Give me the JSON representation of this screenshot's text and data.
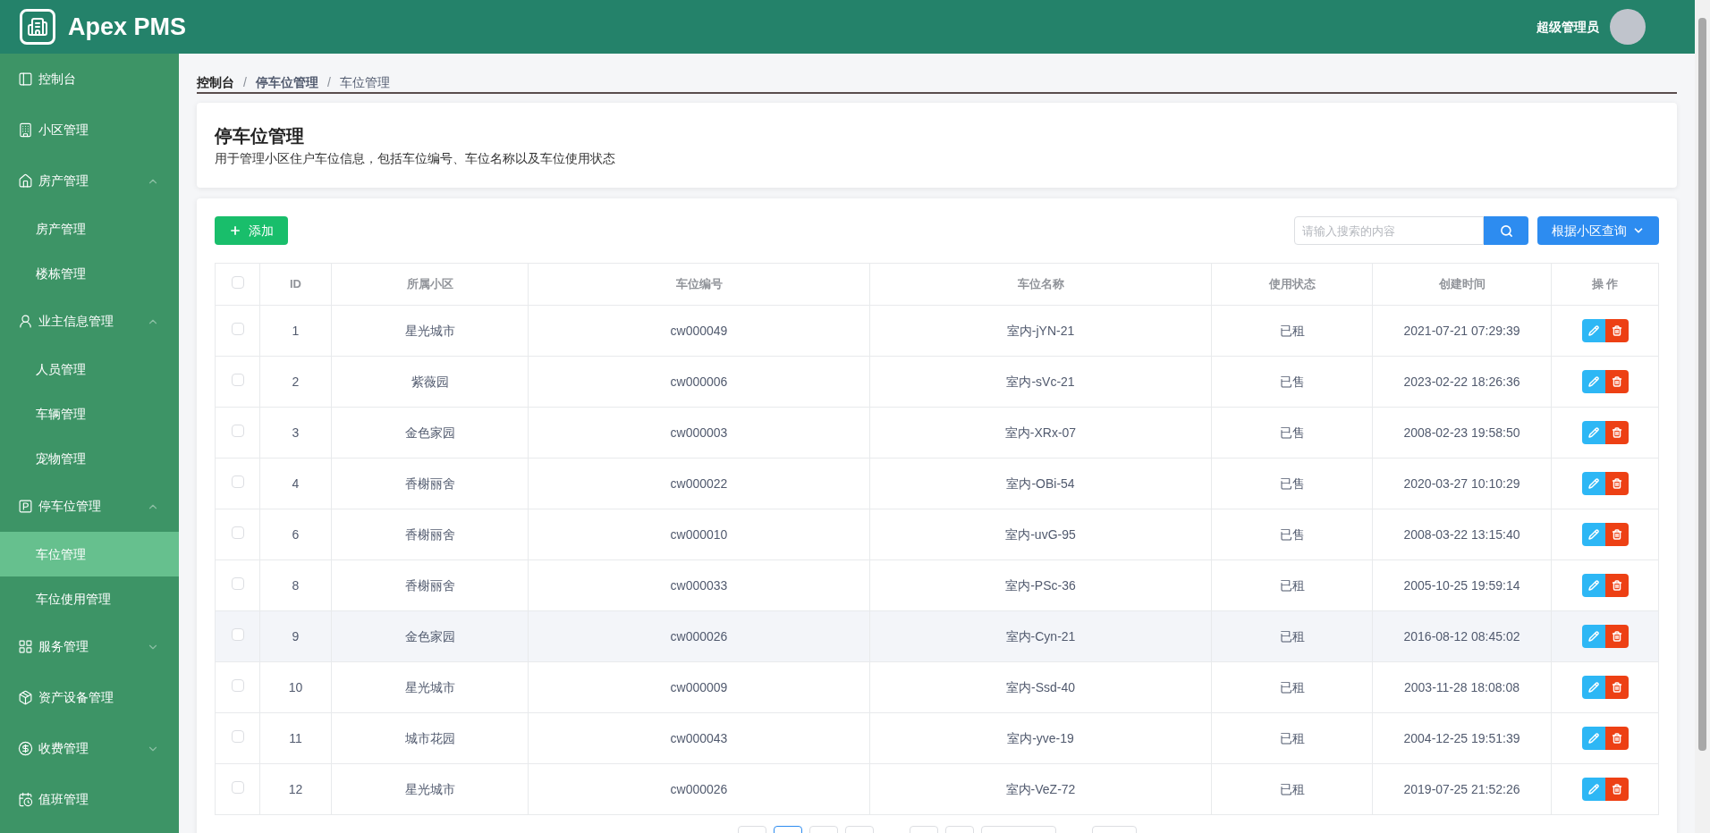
{
  "header": {
    "brand": "Apex PMS",
    "user": "超级管理员"
  },
  "sidebar": {
    "items": [
      {
        "label": "控制台",
        "selected": false
      },
      {
        "label": "小区管理",
        "selected": false
      },
      {
        "label": "房产管理",
        "selected": false,
        "expanded": true,
        "children": [
          {
            "label": "房产管理",
            "selected": false
          },
          {
            "label": "楼栋管理",
            "selected": false
          }
        ]
      },
      {
        "label": "业主信息管理",
        "selected": false,
        "expanded": true,
        "children": [
          {
            "label": "人员管理",
            "selected": false
          },
          {
            "label": "车辆管理",
            "selected": false
          },
          {
            "label": "宠物管理",
            "selected": false
          }
        ]
      },
      {
        "label": "停车位管理",
        "selected": false,
        "expanded": true,
        "children": [
          {
            "label": "车位管理",
            "selected": true
          },
          {
            "label": "车位使用管理",
            "selected": false
          }
        ]
      },
      {
        "label": "服务管理",
        "selected": false,
        "expanded": false
      },
      {
        "label": "资产设备管理",
        "selected": false
      },
      {
        "label": "收费管理",
        "selected": false,
        "expanded": false
      },
      {
        "label": "值班管理",
        "selected": false
      }
    ]
  },
  "breadcrumb": [
    {
      "text": "控制台"
    },
    {
      "separator": "/",
      "text": "停车位管理"
    },
    {
      "separator": "/",
      "text": "车位管理"
    }
  ],
  "page": {
    "title": "停车位管理",
    "description": "用于管理小区住户车位信息，包括车位编号、车位名称以及车位使用状态"
  },
  "toolbar": {
    "add_button": "添加",
    "search": {
      "placeholder": "请输入搜索的内容"
    },
    "filter_button": "根据小区查询"
  },
  "table": {
    "header_checked": false,
    "columns": [
      "ID",
      "所属小区",
      "车位编号",
      "车位名称",
      "使用状态",
      "创建时间",
      "操 作"
    ],
    "rows": [
      {
        "checked": false,
        "hovered": false,
        "cells": [
          "1",
          "星光城市",
          "cw000049",
          "室内-jYN-21",
          "已租",
          "2021-07-21 07:29:39"
        ]
      },
      {
        "checked": false,
        "hovered": false,
        "cells": [
          "2",
          "紫薇园",
          "cw000006",
          "室内-sVc-21",
          "已售",
          "2023-02-22 18:26:36"
        ]
      },
      {
        "checked": false,
        "hovered": false,
        "cells": [
          "3",
          "金色家园",
          "cw000003",
          "室内-XRx-07",
          "已售",
          "2008-02-23 19:58:50"
        ]
      },
      {
        "checked": false,
        "hovered": false,
        "cells": [
          "4",
          "香榭丽舍",
          "cw000022",
          "室内-OBi-54",
          "已售",
          "2020-03-27 10:10:29"
        ]
      },
      {
        "checked": false,
        "hovered": false,
        "cells": [
          "6",
          "香榭丽舍",
          "cw000010",
          "室内-uvG-95",
          "已售",
          "2008-03-22 13:15:40"
        ]
      },
      {
        "checked": false,
        "hovered": false,
        "cells": [
          "8",
          "香榭丽舍",
          "cw000033",
          "室内-PSc-36",
          "已租",
          "2005-10-25 19:59:14"
        ]
      },
      {
        "checked": false,
        "hovered": true,
        "cells": [
          "9",
          "金色家园",
          "cw000026",
          "室内-Cyn-21",
          "已租",
          "2016-08-12 08:45:02"
        ]
      },
      {
        "checked": false,
        "hovered": false,
        "cells": [
          "10",
          "星光城市",
          "cw000009",
          "室内-Ssd-40",
          "已租",
          "2003-11-28 18:08:08"
        ]
      },
      {
        "checked": false,
        "hovered": false,
        "cells": [
          "11",
          "城市花园",
          "cw000043",
          "室内-yve-19",
          "已租",
          "2004-12-25 19:51:39"
        ]
      },
      {
        "checked": false,
        "hovered": false,
        "cells": [
          "12",
          "星光城市",
          "cw000026",
          "室内-VeZ-72",
          "已租",
          "2019-07-25 21:52:26"
        ]
      }
    ]
  },
  "pagination": [
    {
      "kind": "page",
      "selected": false
    },
    {
      "kind": "page",
      "selected": true
    },
    {
      "kind": "page",
      "selected": false
    },
    {
      "kind": "page",
      "selected": false
    },
    {
      "kind": "gap"
    },
    {
      "kind": "page",
      "selected": false
    },
    {
      "kind": "page",
      "selected": false
    },
    {
      "kind": "select"
    },
    {
      "kind": "gap"
    },
    {
      "kind": "input"
    }
  ]
}
